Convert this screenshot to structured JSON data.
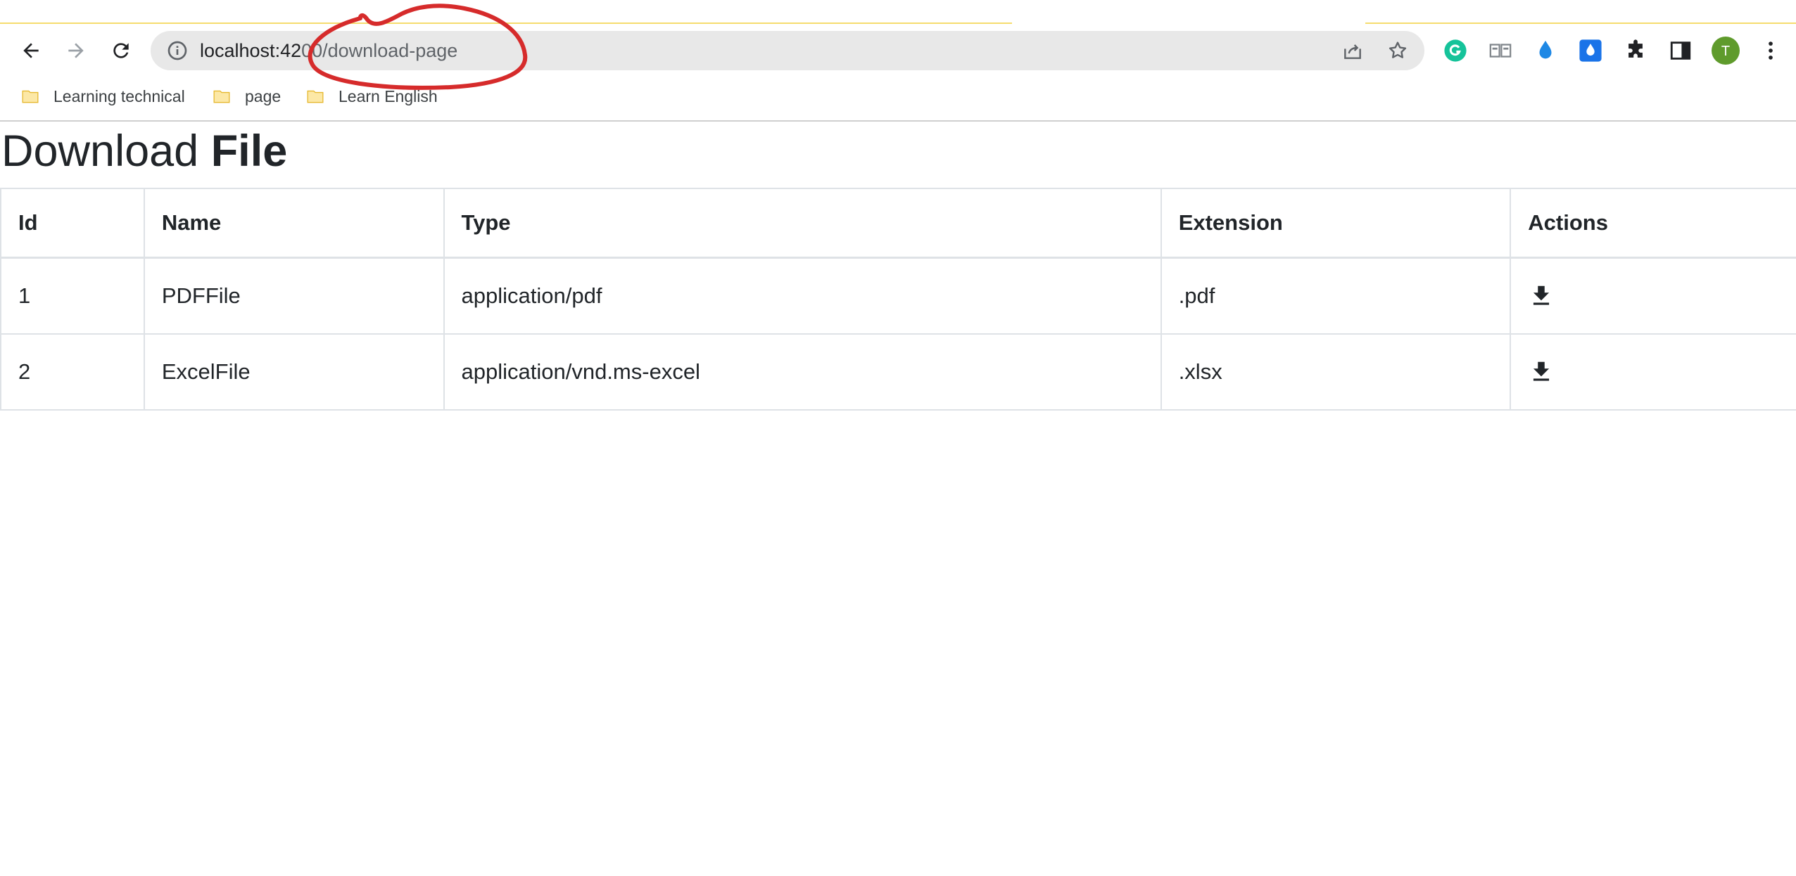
{
  "browser": {
    "url_host": "localhost:42",
    "url_rest": "00/download-page",
    "bookmarks": [
      {
        "label": "Learning technical"
      },
      {
        "label": "page"
      },
      {
        "label": "Learn English"
      }
    ],
    "profile_initial": "T",
    "colors": {
      "grammarly": "#15c39a",
      "profile": "#5f9b2c",
      "ext_blue": "#1a73e8"
    }
  },
  "page": {
    "title_light": "Download",
    "title_bold": "File",
    "table": {
      "headers": [
        "Id",
        "Name",
        "Type",
        "Extension",
        "Actions"
      ],
      "rows": [
        {
          "id": "1",
          "name": "PDFFile",
          "type": "application/pdf",
          "extension": ".pdf"
        },
        {
          "id": "2",
          "name": "ExcelFile",
          "type": "application/vnd.ms-excel",
          "extension": ".xlsx"
        }
      ]
    }
  },
  "annotation_color": "#d62b2b"
}
